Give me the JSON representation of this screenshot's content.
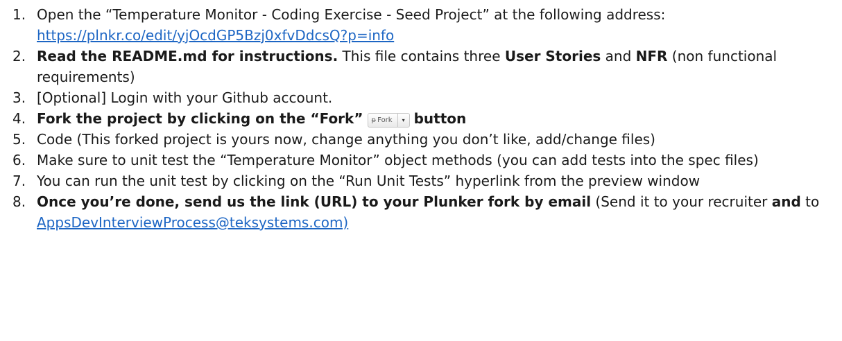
{
  "items": [
    {
      "num": "1.",
      "text": "Open the “Temperature Monitor - Coding Exercise - Seed Project” at the following address:",
      "link": "https://plnkr.co/edit/yjOcdGP5Bzj0xfvDdcsQ?p=info"
    },
    {
      "num": "2.",
      "bold_lead": "Read the README.md for instructions.",
      "text_a": " This file contains three ",
      "bold_a": "User Stories",
      "text_b": " and ",
      "bold_b": "NFR",
      "text_c": " (non functional requirements)"
    },
    {
      "num": "3.",
      "text": " [Optional] Login with your Github account."
    },
    {
      "num": "4.",
      "bold_lead": "Fork the project by clicking on the “Fork”",
      "fork_widget": {
        "icon": "fork-icon",
        "label": "Fork",
        "caret": "▾"
      },
      "bold_tail": "button"
    },
    {
      "num": "5.",
      "text": "Code (This forked project is yours now, change anything you don’t like, add/change files)"
    },
    {
      "num": "6.",
      "text": "Make sure to unit test the “Temperature Monitor” object methods (you can add tests into the spec files)"
    },
    {
      "num": "7.",
      "text": "You can run the unit test by clicking on the “Run Unit Tests” hyperlink from the preview window"
    },
    {
      "num": "8.",
      "bold_lead": "Once you’re done, send us the link (URL) to your Plunker fork by email",
      "text_a": " (Send it to your recruiter ",
      "bold_a": "and",
      "text_b": " to ",
      "link": "AppsDevInterviewProcess@teksystems.com)"
    }
  ],
  "colors": {
    "text": "#1a1a1a",
    "link": "#1d66c4"
  }
}
